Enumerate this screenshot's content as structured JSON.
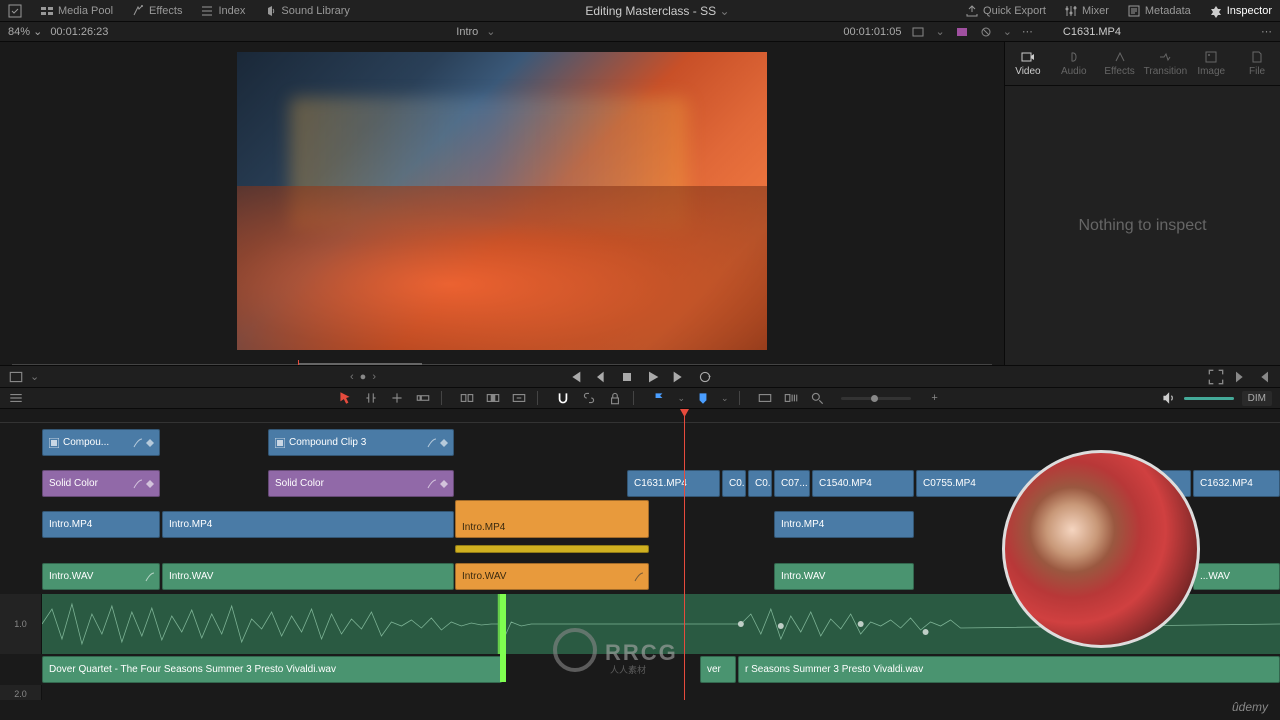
{
  "header": {
    "media_pool": "Media Pool",
    "effects": "Effects",
    "index": "Index",
    "sound_library": "Sound Library",
    "project_title": "Editing Masterclass - SS",
    "quick_export": "Quick Export",
    "mixer": "Mixer",
    "metadata": "Metadata",
    "inspector": "Inspector"
  },
  "subbar": {
    "zoom_pct": "84%",
    "src_tc": "00:01:26:23",
    "center_label": "Intro",
    "rec_tc": "00:01:01:05",
    "clip_name": "C1631.MP4"
  },
  "inspector": {
    "tabs": {
      "video": "Video",
      "audio": "Audio",
      "effects": "Effects",
      "transition": "Transition",
      "image": "Image",
      "file": "File"
    },
    "body": "Nothing to inspect"
  },
  "toolbar": {
    "dim": "DIM"
  },
  "timeline": {
    "gain_label_1": "1.0",
    "gain_label_2": "2.0",
    "clips": {
      "compound1": "Compou...",
      "compound3": "Compound Clip 3",
      "solid1": "Solid Color",
      "solid2": "Solid Color",
      "intro_v1a": "Intro.MP4",
      "intro_v1b": "Intro.MP4",
      "intro_o1": "Intro.MP4",
      "c1631": "C1631.MP4",
      "c0a": "C0...",
      "c0b": "C0...",
      "c07": "C07...",
      "c1540": "C1540.MP4",
      "c0755": "C0755.MP4",
      "c1632": "C1632.MP4",
      "intro_v2": "Intro.MP4",
      "intro_a1a": "Intro.WAV",
      "intro_a1b": "Intro.WAV",
      "intro_a1c": "Intro.WAV",
      "intro_a2": "Intro.WAV",
      "wav_tail": "...WAV",
      "dover": "Dover Quartet - The Four Seasons Summer 3 Presto Vivaldi.wav",
      "dover2": "r Seasons Summer 3 Presto Vivaldi.wav",
      "dover_pre": "ver"
    }
  },
  "branding": {
    "udemy": "ûdemy"
  }
}
